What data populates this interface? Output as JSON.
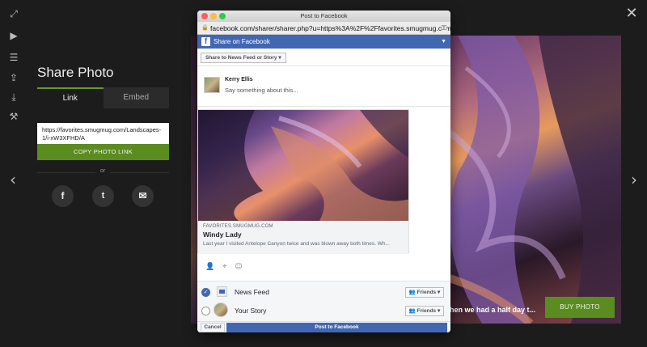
{
  "share": {
    "title": "Share Photo",
    "tabs": [
      {
        "label": "Link"
      },
      {
        "label": "Embed"
      }
    ],
    "link_value": "https://favorites.smugmug.com/Landscapes-1/i-xW3XFHD/A",
    "copy_label": "COPY PHOTO LINK",
    "or_label": "or"
  },
  "photo": {
    "caption": "hen we had a half day t...",
    "buy_label": "BUY PHOTO"
  },
  "popup": {
    "window_title": "Post to Facebook",
    "url": "facebook.com/sharer/sharer.php?u=https%3A%2F%2Ffavorites.smugmug.com%2F...",
    "header_title": "Share on Facebook",
    "destination": "Share to News Feed or Story",
    "user_name": "Kerry Ellis",
    "composer_placeholder": "Say something about this...",
    "preview": {
      "site": "FAVORITES.SMUGMUG.COM",
      "title": "Windy Lady",
      "description": "Last year I visited Antelope Canyon twice and was blown away both times. Wh..."
    },
    "audience": [
      {
        "label": "News Feed",
        "privacy": "Friends",
        "checked": true
      },
      {
        "label": "Your Story",
        "privacy": "Friends",
        "checked": false
      }
    ],
    "cancel_label": "Cancel",
    "post_label": "Post to Facebook"
  },
  "colors": {
    "accent_green": "#5a8c1f",
    "facebook_blue": "#4267b2",
    "background": "#1c1c1c"
  },
  "icons": {
    "left_toolbar": [
      "expand-icon",
      "play-icon",
      "menu-icon",
      "share-icon",
      "download-icon",
      "wrench-icon"
    ],
    "social": [
      "facebook-icon",
      "twitter-icon",
      "email-icon"
    ]
  }
}
